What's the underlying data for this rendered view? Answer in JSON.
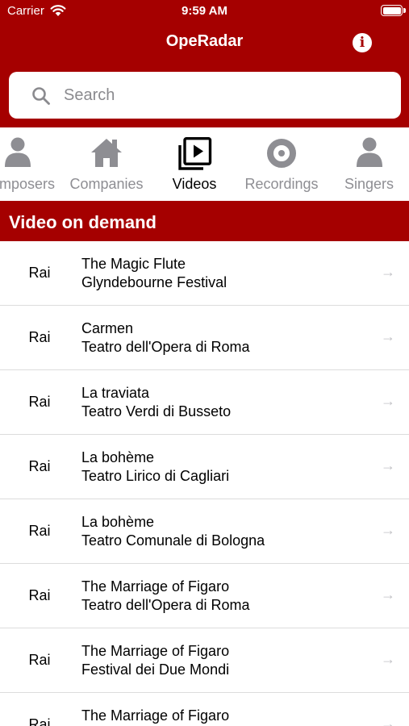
{
  "status_bar": {
    "carrier": "Carrier",
    "time": "9:59 AM",
    "wifi_icon": "wifi-icon",
    "battery_icon": "battery-icon"
  },
  "navbar": {
    "title": "OpeRadar",
    "info_icon": "info-icon",
    "info_glyph": "i"
  },
  "search": {
    "placeholder": "Search",
    "value": ""
  },
  "tabs": [
    {
      "label": "Composers",
      "icon": "person-icon",
      "active": false
    },
    {
      "label": "Companies",
      "icon": "house-icon",
      "active": false
    },
    {
      "label": "Videos",
      "icon": "play-stack-icon",
      "active": true
    },
    {
      "label": "Recordings",
      "icon": "disc-icon",
      "active": false
    },
    {
      "label": "Singers",
      "icon": "person-icon",
      "active": false
    }
  ],
  "section": {
    "title": "Video on demand"
  },
  "videos": [
    {
      "source": "Rai",
      "title": "The Magic Flute",
      "venue": "Glyndebourne Festival"
    },
    {
      "source": "Rai",
      "title": "Carmen",
      "venue": "Teatro dell'Opera di Roma"
    },
    {
      "source": "Rai",
      "title": "La traviata",
      "venue": "Teatro Verdi di Busseto"
    },
    {
      "source": "Rai",
      "title": "La bohème",
      "venue": "Teatro Lirico di Cagliari"
    },
    {
      "source": "Rai",
      "title": "La bohème",
      "venue": "Teatro Comunale di Bologna"
    },
    {
      "source": "Rai",
      "title": "The Marriage of Figaro",
      "venue": "Teatro dell'Opera di Roma"
    },
    {
      "source": "Rai",
      "title": "The Marriage of Figaro",
      "venue": "Festival dei Due Mondi"
    },
    {
      "source": "Rai",
      "title": "The Marriage of Figaro",
      "venue": ""
    }
  ],
  "row_arrow": "→",
  "colors": {
    "brand": "#a50000",
    "tab_inactive": "#8e8e93",
    "tab_active": "#000000",
    "separator": "#dcdcdc",
    "chevron": "#c2c2c6"
  }
}
